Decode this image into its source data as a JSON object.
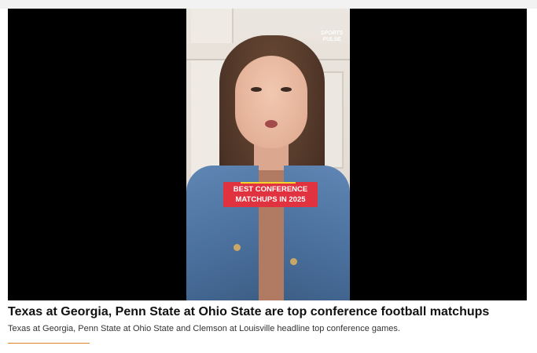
{
  "video": {
    "logo_line1": "SPORTS",
    "logo_line2": "PULSE",
    "caption_line1": "BEST CONFERENCE",
    "caption_line2": "MATCHUPS IN 2025"
  },
  "article": {
    "headline": "Texas at Georgia, Penn State at Ohio State are top conference football matchups",
    "summary": "Texas at Georgia, Penn State at Ohio State and Clemson at Louisville headline top conference games."
  },
  "colors": {
    "caption_bg": "#e0323f",
    "accent_rule": "#d9822b",
    "player_bg": "#000000"
  }
}
